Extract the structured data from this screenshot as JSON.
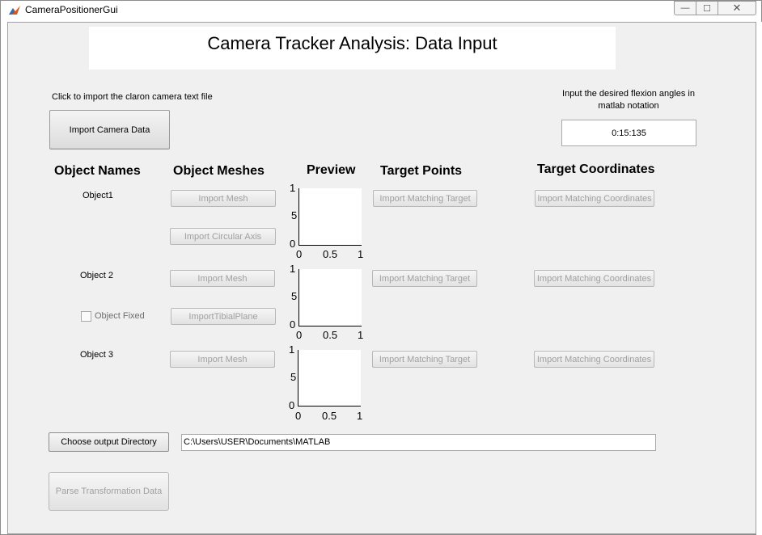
{
  "window": {
    "title": "CameraPositionerGui"
  },
  "header": {
    "title": "Camera Tracker Analysis: Data Input"
  },
  "import_section": {
    "instruction": "Click to import the claron camera text file",
    "button_label": "Import Camera Data"
  },
  "flexion": {
    "instruction": "Input the desired flexion angles in matlab notation",
    "value": "0:15:135"
  },
  "columns": {
    "names": "Object Names",
    "meshes": "Object Meshes",
    "preview": "Preview",
    "targets": "Target Points",
    "coords": "Target Coordinates"
  },
  "objects": [
    {
      "name": "Object1",
      "mesh_button": "Import Mesh",
      "extra_button": "Import Circular Axis",
      "target_button": "Import Matching Target",
      "coords_button": "Import Matching Coordinates"
    },
    {
      "name": "Object 2",
      "mesh_button": "Import Mesh",
      "extra_button": "ImportTibialPlane",
      "checkbox_label": "Object Fixed",
      "checkbox_checked": false,
      "target_button": "Import Matching Target",
      "coords_button": "Import Matching Coordinates"
    },
    {
      "name": "Object 3",
      "mesh_button": "Import Mesh",
      "target_button": "Import Matching Target",
      "coords_button": "Import Matching Coordinates"
    }
  ],
  "preview_axes": {
    "y_ticks": [
      "1",
      "5",
      "0"
    ],
    "x_ticks": [
      "0",
      "0.5",
      "1"
    ]
  },
  "output": {
    "button_label": "Choose output Directory",
    "path": "C:\\Users\\USER\\Documents\\MATLAB"
  },
  "parse": {
    "button_label": "Parse Transformation Data"
  },
  "window_controls": {
    "minimize": "—",
    "maximize": "☐",
    "close": "✕"
  }
}
